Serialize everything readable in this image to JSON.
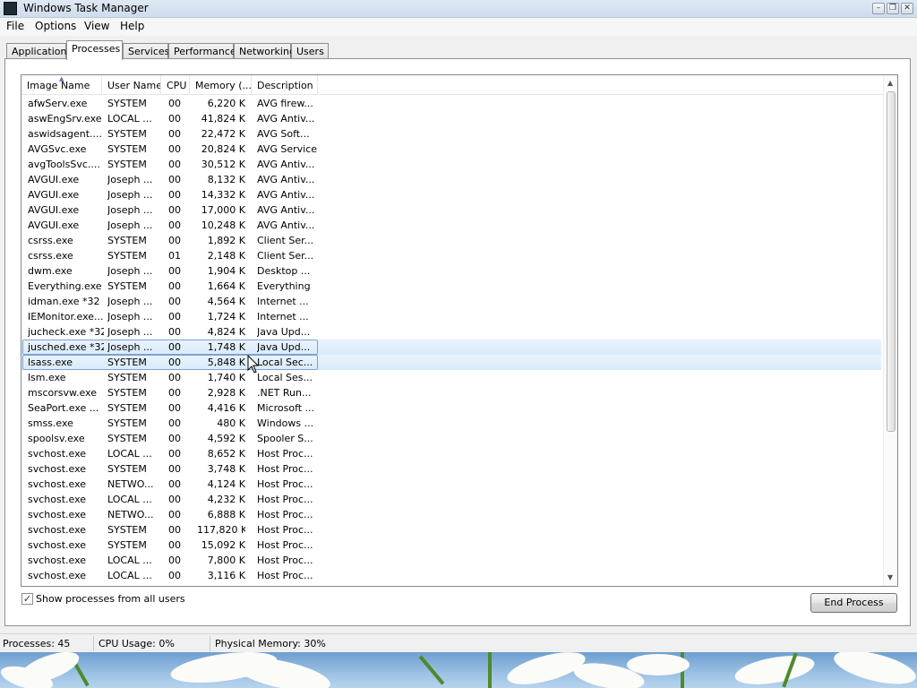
{
  "window": {
    "title": "Windows Task Manager"
  },
  "menu": [
    "File",
    "Options",
    "View",
    "Help"
  ],
  "tabs": [
    "Applications",
    "Processes",
    "Services",
    "Performance",
    "Networking",
    "Users"
  ],
  "active_tab": "Processes",
  "columns": [
    "Image Name",
    "User Name",
    "CPU",
    "Memory (...",
    "Description"
  ],
  "processes": [
    {
      "name": "afwServ.exe",
      "user": "SYSTEM",
      "cpu": "00",
      "mem": "6,220 K",
      "desc": "AVG firew..."
    },
    {
      "name": "aswEngSrv.exe",
      "user": "LOCAL ...",
      "cpu": "00",
      "mem": "41,824 K",
      "desc": "AVG Antiv..."
    },
    {
      "name": "aswidsagent....",
      "user": "SYSTEM",
      "cpu": "00",
      "mem": "22,472 K",
      "desc": "AVG Soft..."
    },
    {
      "name": "AVGSvc.exe",
      "user": "SYSTEM",
      "cpu": "00",
      "mem": "20,824 K",
      "desc": "AVG Service"
    },
    {
      "name": "avgToolsSvc....",
      "user": "SYSTEM",
      "cpu": "00",
      "mem": "30,512 K",
      "desc": "AVG Antiv..."
    },
    {
      "name": "AVGUI.exe",
      "user": "Joseph ...",
      "cpu": "00",
      "mem": "8,132 K",
      "desc": "AVG Antiv..."
    },
    {
      "name": "AVGUI.exe",
      "user": "Joseph ...",
      "cpu": "00",
      "mem": "14,332 K",
      "desc": "AVG Antiv..."
    },
    {
      "name": "AVGUI.exe",
      "user": "Joseph ...",
      "cpu": "00",
      "mem": "17,000 K",
      "desc": "AVG Antiv..."
    },
    {
      "name": "AVGUI.exe",
      "user": "Joseph ...",
      "cpu": "00",
      "mem": "10,248 K",
      "desc": "AVG Antiv..."
    },
    {
      "name": "csrss.exe",
      "user": "SYSTEM",
      "cpu": "00",
      "mem": "1,892 K",
      "desc": "Client Ser..."
    },
    {
      "name": "csrss.exe",
      "user": "SYSTEM",
      "cpu": "01",
      "mem": "2,148 K",
      "desc": "Client Ser..."
    },
    {
      "name": "dwm.exe",
      "user": "Joseph ...",
      "cpu": "00",
      "mem": "1,904 K",
      "desc": "Desktop ..."
    },
    {
      "name": "Everything.exe",
      "user": "SYSTEM",
      "cpu": "00",
      "mem": "1,664 K",
      "desc": "Everything"
    },
    {
      "name": "idman.exe *32",
      "user": "Joseph ...",
      "cpu": "00",
      "mem": "4,564 K",
      "desc": "Internet ..."
    },
    {
      "name": "IEMonitor.exe...",
      "user": "Joseph ...",
      "cpu": "00",
      "mem": "1,724 K",
      "desc": "Internet ..."
    },
    {
      "name": "jucheck.exe *32",
      "user": "Joseph ...",
      "cpu": "00",
      "mem": "4,824 K",
      "desc": "Java Upd..."
    },
    {
      "name": "jusched.exe *32",
      "user": "Joseph ...",
      "cpu": "00",
      "mem": "1,748 K",
      "desc": "Java Upd...",
      "selected": true
    },
    {
      "name": "lsass.exe",
      "user": "SYSTEM",
      "cpu": "00",
      "mem": "5,848 K",
      "desc": "Local Sec...",
      "selected": true
    },
    {
      "name": "lsm.exe",
      "user": "SYSTEM",
      "cpu": "00",
      "mem": "1,740 K",
      "desc": "Local Ses..."
    },
    {
      "name": "mscorsvw.exe",
      "user": "SYSTEM",
      "cpu": "00",
      "mem": "2,928 K",
      "desc": ".NET Run..."
    },
    {
      "name": "SeaPort.exe ...",
      "user": "SYSTEM",
      "cpu": "00",
      "mem": "4,416 K",
      "desc": "Microsoft ..."
    },
    {
      "name": "smss.exe",
      "user": "SYSTEM",
      "cpu": "00",
      "mem": "480 K",
      "desc": "Windows ..."
    },
    {
      "name": "spoolsv.exe",
      "user": "SYSTEM",
      "cpu": "00",
      "mem": "4,592 K",
      "desc": "Spooler S..."
    },
    {
      "name": "svchost.exe",
      "user": "LOCAL ...",
      "cpu": "00",
      "mem": "8,652 K",
      "desc": "Host Proc..."
    },
    {
      "name": "svchost.exe",
      "user": "SYSTEM",
      "cpu": "00",
      "mem": "3,748 K",
      "desc": "Host Proc..."
    },
    {
      "name": "svchost.exe",
      "user": "NETWO...",
      "cpu": "00",
      "mem": "4,124 K",
      "desc": "Host Proc..."
    },
    {
      "name": "svchost.exe",
      "user": "LOCAL ...",
      "cpu": "00",
      "mem": "4,232 K",
      "desc": "Host Proc..."
    },
    {
      "name": "svchost.exe",
      "user": "NETWO...",
      "cpu": "00",
      "mem": "6,888 K",
      "desc": "Host Proc..."
    },
    {
      "name": "svchost.exe",
      "user": "SYSTEM",
      "cpu": "00",
      "mem": "117,820 K",
      "desc": "Host Proc..."
    },
    {
      "name": "svchost.exe",
      "user": "SYSTEM",
      "cpu": "00",
      "mem": "15,092 K",
      "desc": "Host Proc..."
    },
    {
      "name": "svchost.exe",
      "user": "LOCAL ...",
      "cpu": "00",
      "mem": "7,800 K",
      "desc": "Host Proc..."
    },
    {
      "name": "svchost.exe",
      "user": "LOCAL ...",
      "cpu": "00",
      "mem": "3,116 K",
      "desc": "Host Proc..."
    }
  ],
  "show_all_users": {
    "label": "Show processes from all users",
    "checked": true
  },
  "end_process_label": "End Process",
  "status": {
    "processes": "Processes: 45",
    "cpu": "CPU Usage: 0%",
    "memory": "Physical Memory: 30%"
  },
  "icons": {
    "app": "task-manager-icon",
    "minimize": "minimize-icon",
    "maximize": "maximize-icon",
    "close": "close-icon",
    "cursor": "mouse-pointer-icon"
  },
  "colors": {
    "selection_border": "#7da2ce",
    "selection_fill": "#d9ebfb"
  }
}
